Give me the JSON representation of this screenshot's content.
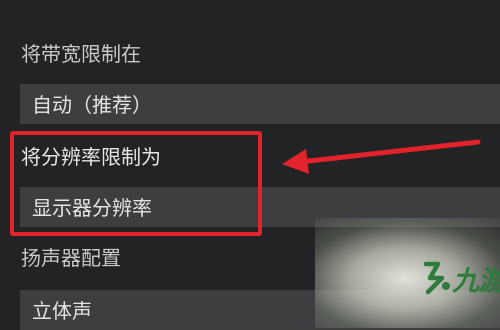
{
  "settings": {
    "bandwidth": {
      "label": "将带宽限制在",
      "value": "自动（推荐）"
    },
    "resolution": {
      "label": "将分辨率限制为",
      "value": "显示器分辨率"
    },
    "speaker": {
      "label": "扬声器配置",
      "value": "立体声"
    }
  },
  "annotation": {
    "highlight_color": "#e3232b",
    "arrow_color": "#e3232b"
  },
  "watermark": {
    "text": "九游",
    "icon": "jiuyou-logo-icon",
    "color": "#2f7a3d"
  }
}
